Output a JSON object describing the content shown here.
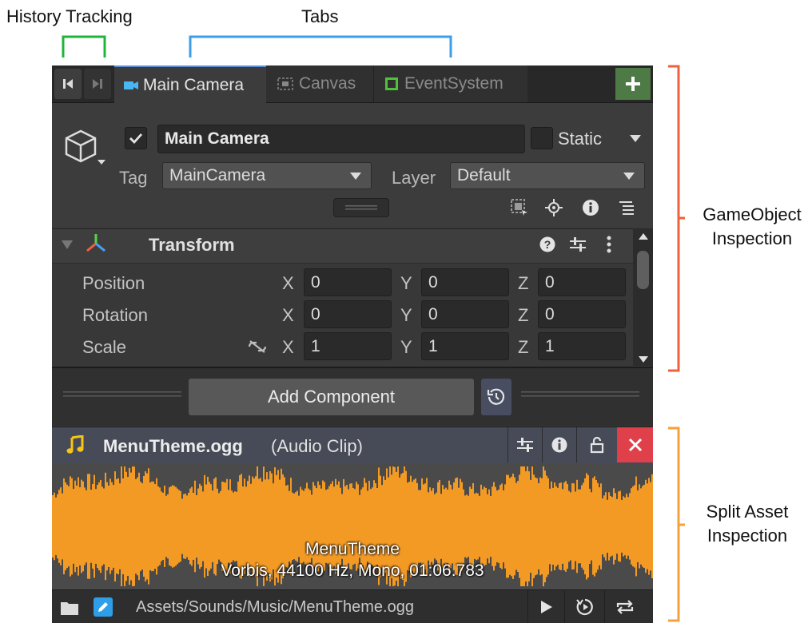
{
  "annotations": {
    "history_tracking": "History Tracking",
    "tabs": "Tabs",
    "gameobject_inspection": [
      "GameObject",
      "Inspection"
    ],
    "split_asset_inspection": [
      "Split Asset",
      "Inspection"
    ]
  },
  "colors": {
    "history_bracket": "#1fb53a",
    "tabs_bracket": "#3c9ee6",
    "gameobject_bracket": "#f0603c",
    "asset_bracket": "#f5a23a",
    "waveform": "#f39a25",
    "add_tab_button": "#4e7a46",
    "close_button": "#e0404a"
  },
  "toolbar": {
    "back_icon": "skip-back-icon",
    "forward_icon": "skip-forward-icon",
    "tabs": [
      {
        "label": "Main Camera",
        "icon": "camera-icon",
        "active": true
      },
      {
        "label": "Canvas",
        "icon": "canvas-icon",
        "active": false
      },
      {
        "label": "EventSystem",
        "icon": "eventsystem-icon",
        "active": false
      }
    ],
    "add_tab_icon": "plus-icon"
  },
  "gameobject": {
    "active_checked": true,
    "name": "Main Camera",
    "static_label": "Static",
    "static_checked": false,
    "tag_label": "Tag",
    "tag_value": "MainCamera",
    "layer_label": "Layer",
    "layer_value": "Default",
    "header_icons": [
      "select-icon",
      "target-icon",
      "info-icon",
      "list-icon"
    ]
  },
  "transform": {
    "title": "Transform",
    "rows": [
      {
        "label": "Position",
        "x": "0",
        "y": "0",
        "z": "0",
        "constrain": false
      },
      {
        "label": "Rotation",
        "x": "0",
        "y": "0",
        "z": "0",
        "constrain": false
      },
      {
        "label": "Scale",
        "x": "1",
        "y": "1",
        "z": "1",
        "constrain": true
      }
    ],
    "axis_labels": {
      "x": "X",
      "y": "Y",
      "z": "Z"
    }
  },
  "add_component": {
    "label": "Add Component"
  },
  "asset": {
    "name": "MenuTheme.ogg",
    "type": "(Audio Clip)",
    "clip_name": "MenuTheme",
    "clip_info": "Vorbis, 44100 Hz, Mono, 01:06.783",
    "path": "Assets/Sounds/Music/MenuTheme.ogg"
  }
}
